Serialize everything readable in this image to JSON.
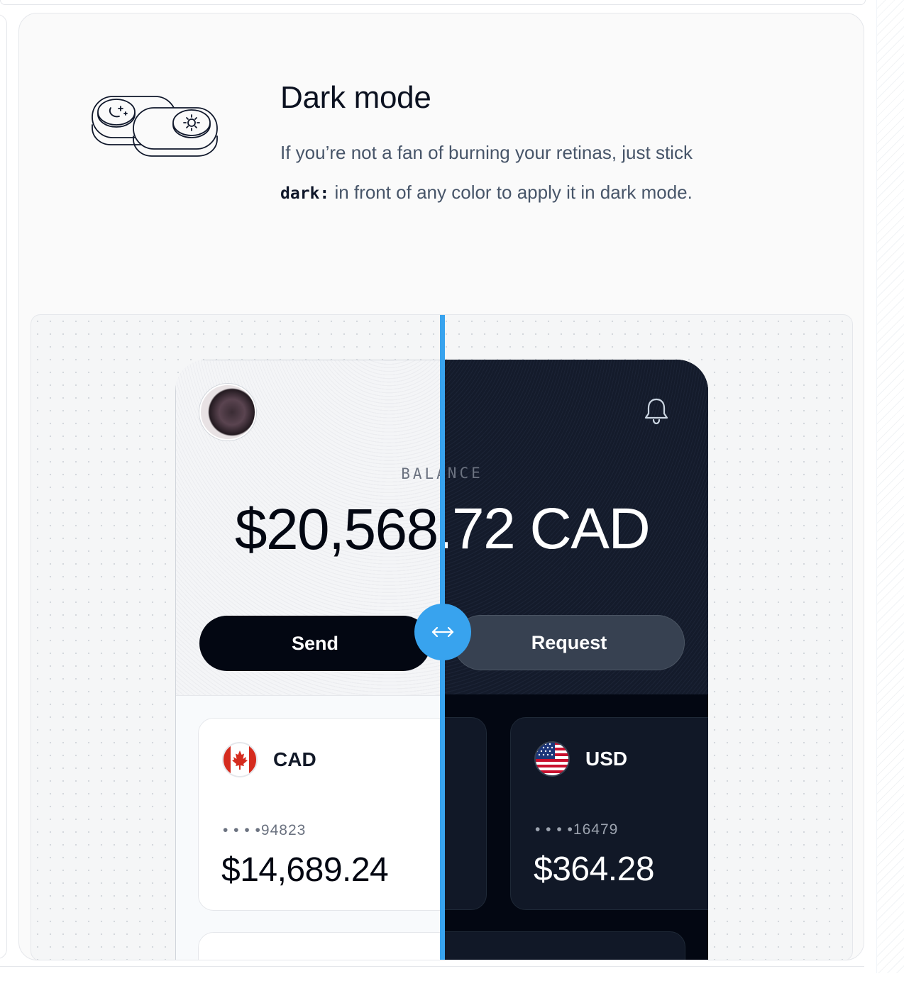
{
  "feature": {
    "title": "Dark mode",
    "description_before": "If you’re not a fan of burning your retinas, just stick",
    "code": "dark:",
    "description_after": " in front of any color to apply it in dark mode.",
    "icon": "toggle-switches-icon"
  },
  "phone": {
    "balance_label": "BALANCE",
    "balance_amount": "$20,568.72 CAD",
    "send_label": "Send",
    "request_label": "Request",
    "avatar": "user-avatar",
    "notification_icon": "bell-icon",
    "accounts": [
      {
        "code": "CAD",
        "number": "• • • •94823",
        "balance": "$14,689.24",
        "flag": "canada-flag-icon"
      },
      {
        "code": "USD",
        "number": "• • • •16479",
        "balance": "$364.28",
        "flag": "us-flag-icon"
      }
    ]
  },
  "comparison_slider": {
    "icon": "double-arrow-icon"
  },
  "colors": {
    "accent": "#38a3ee",
    "dark_background": "#030712",
    "dark_surface": "#111827",
    "light_background": "#f8fafc"
  }
}
